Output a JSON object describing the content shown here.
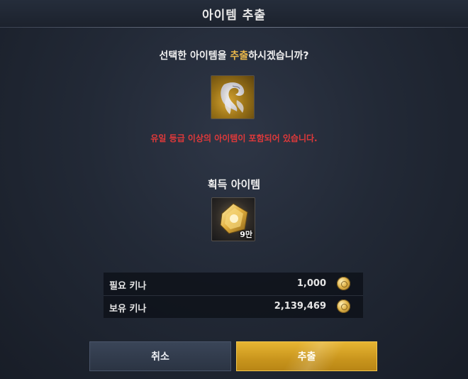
{
  "header": {
    "title": "아이템 추출"
  },
  "prompt": {
    "before": "선택한 아이템을 ",
    "highlight": "추출",
    "after": "하시겠습니까?",
    "highlight_color": "#e8b64a"
  },
  "source_item": {
    "icon": "white-fox-feather-icon",
    "grade_color": "#c79a2a"
  },
  "warning": {
    "text": "유일 등급 이상의 아이템이 포함되어 있습니다.",
    "color": "#e0393a"
  },
  "acquired": {
    "title": "획득 아이템",
    "item": {
      "icon": "gold-ornament-icon",
      "count": "9만"
    }
  },
  "costs": {
    "required": {
      "label": "필요 키나",
      "value": "1,000",
      "icon": "kinah-coin-icon"
    },
    "owned": {
      "label": "보유 키나",
      "value": "2,139,469",
      "icon": "kinah-coin-icon"
    }
  },
  "buttons": {
    "cancel": "취소",
    "extract": "추출",
    "extract_color": "#d9a62a",
    "cancel_color": "#33404f"
  }
}
